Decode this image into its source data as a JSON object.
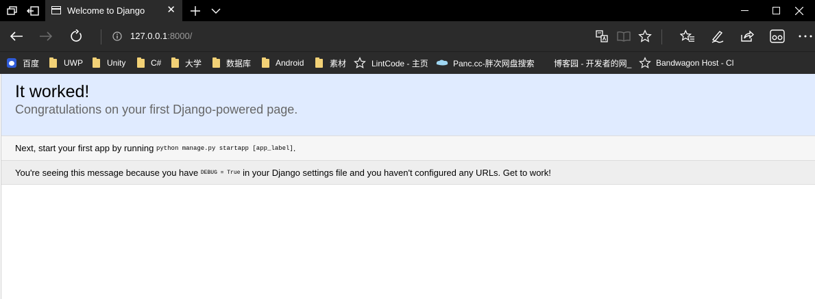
{
  "browser": {
    "tab": {
      "title": "Welcome to Django"
    },
    "address": {
      "host": "127.0.0.1",
      "path": ":8000/"
    },
    "favorites": [
      {
        "label": "百度",
        "icon": "baidu-icon"
      },
      {
        "label": "UWP",
        "icon": "folder-icon"
      },
      {
        "label": "Unity",
        "icon": "folder-icon"
      },
      {
        "label": "C#",
        "icon": "folder-icon"
      },
      {
        "label": "大学",
        "icon": "folder-icon"
      },
      {
        "label": "数据库",
        "icon": "folder-icon"
      },
      {
        "label": "Android",
        "icon": "folder-icon"
      },
      {
        "label": "素材",
        "icon": "folder-icon"
      },
      {
        "label": "LintCode - 主页",
        "icon": "star-icon"
      },
      {
        "label": "Panc.cc-胖次网盘搜索",
        "icon": "cloud-icon"
      },
      {
        "label": "博客园 - 开发者的网_",
        "icon": "none"
      },
      {
        "label": "Bandwagon Host - Cl",
        "icon": "star-icon"
      }
    ]
  },
  "page": {
    "title": "It worked!",
    "subtitle": "Congratulations on your first Django-powered page.",
    "instructions": {
      "prefix": "Next, start your first app by running ",
      "code": "python manage.py startapp [app_label]",
      "suffix": "."
    },
    "explanation": {
      "prefix": "You're seeing this message because you have ",
      "code": "DEBUG = True",
      "suffix": " in your Django settings file and you haven't configured any URLs. Get to work!"
    }
  },
  "colors": {
    "chrome": "#2b2b2b",
    "titlebar": "#000000",
    "summary_bg": "#e0ebff",
    "instructions_bg": "#f6f6f6",
    "explanation_bg": "#eeeeee"
  }
}
